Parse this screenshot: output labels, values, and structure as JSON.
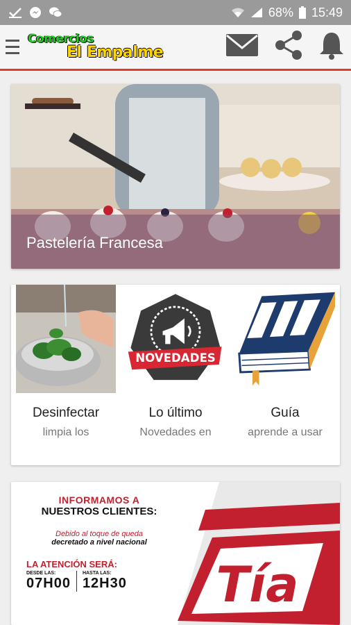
{
  "status_bar": {
    "battery": "68%",
    "time": "15:49",
    "icons": [
      "check-icon",
      "messenger-icon",
      "wechat-icon",
      "wifi-icon",
      "signal-icon",
      "battery-icon"
    ]
  },
  "app_bar": {
    "logo_line1": "Comercios",
    "logo_line2": "El Empalme",
    "actions": [
      "mail-icon",
      "share-icon",
      "bell-icon"
    ],
    "accent": "#e53a2a"
  },
  "hero": {
    "caption": "Pastelería Francesa"
  },
  "tiles": [
    {
      "title": "Desinfectar",
      "sub": "limpia los",
      "image": "lettuce-washing-photo"
    },
    {
      "title": "Lo último",
      "sub": "Novedades en",
      "badge": "NOVEDADES",
      "image": "megaphone-badge"
    },
    {
      "title": "Guía",
      "sub": "aprende a usar",
      "image": "book-icon"
    }
  ],
  "banner": {
    "line1": "INFORMAMOS A",
    "line2": "NUESTROS CLIENTES:",
    "line3": "Debido al toque de queda",
    "line4": "decretado a nivel nacional",
    "line5": "LA ATENCIÓN SERÁ:",
    "from_label": "DESDE LAS:",
    "from_time": "07H00",
    "to_label": "HASTA LAS:",
    "to_time": "12H30",
    "brand": "Tía",
    "brand_color": "#c2202e"
  }
}
